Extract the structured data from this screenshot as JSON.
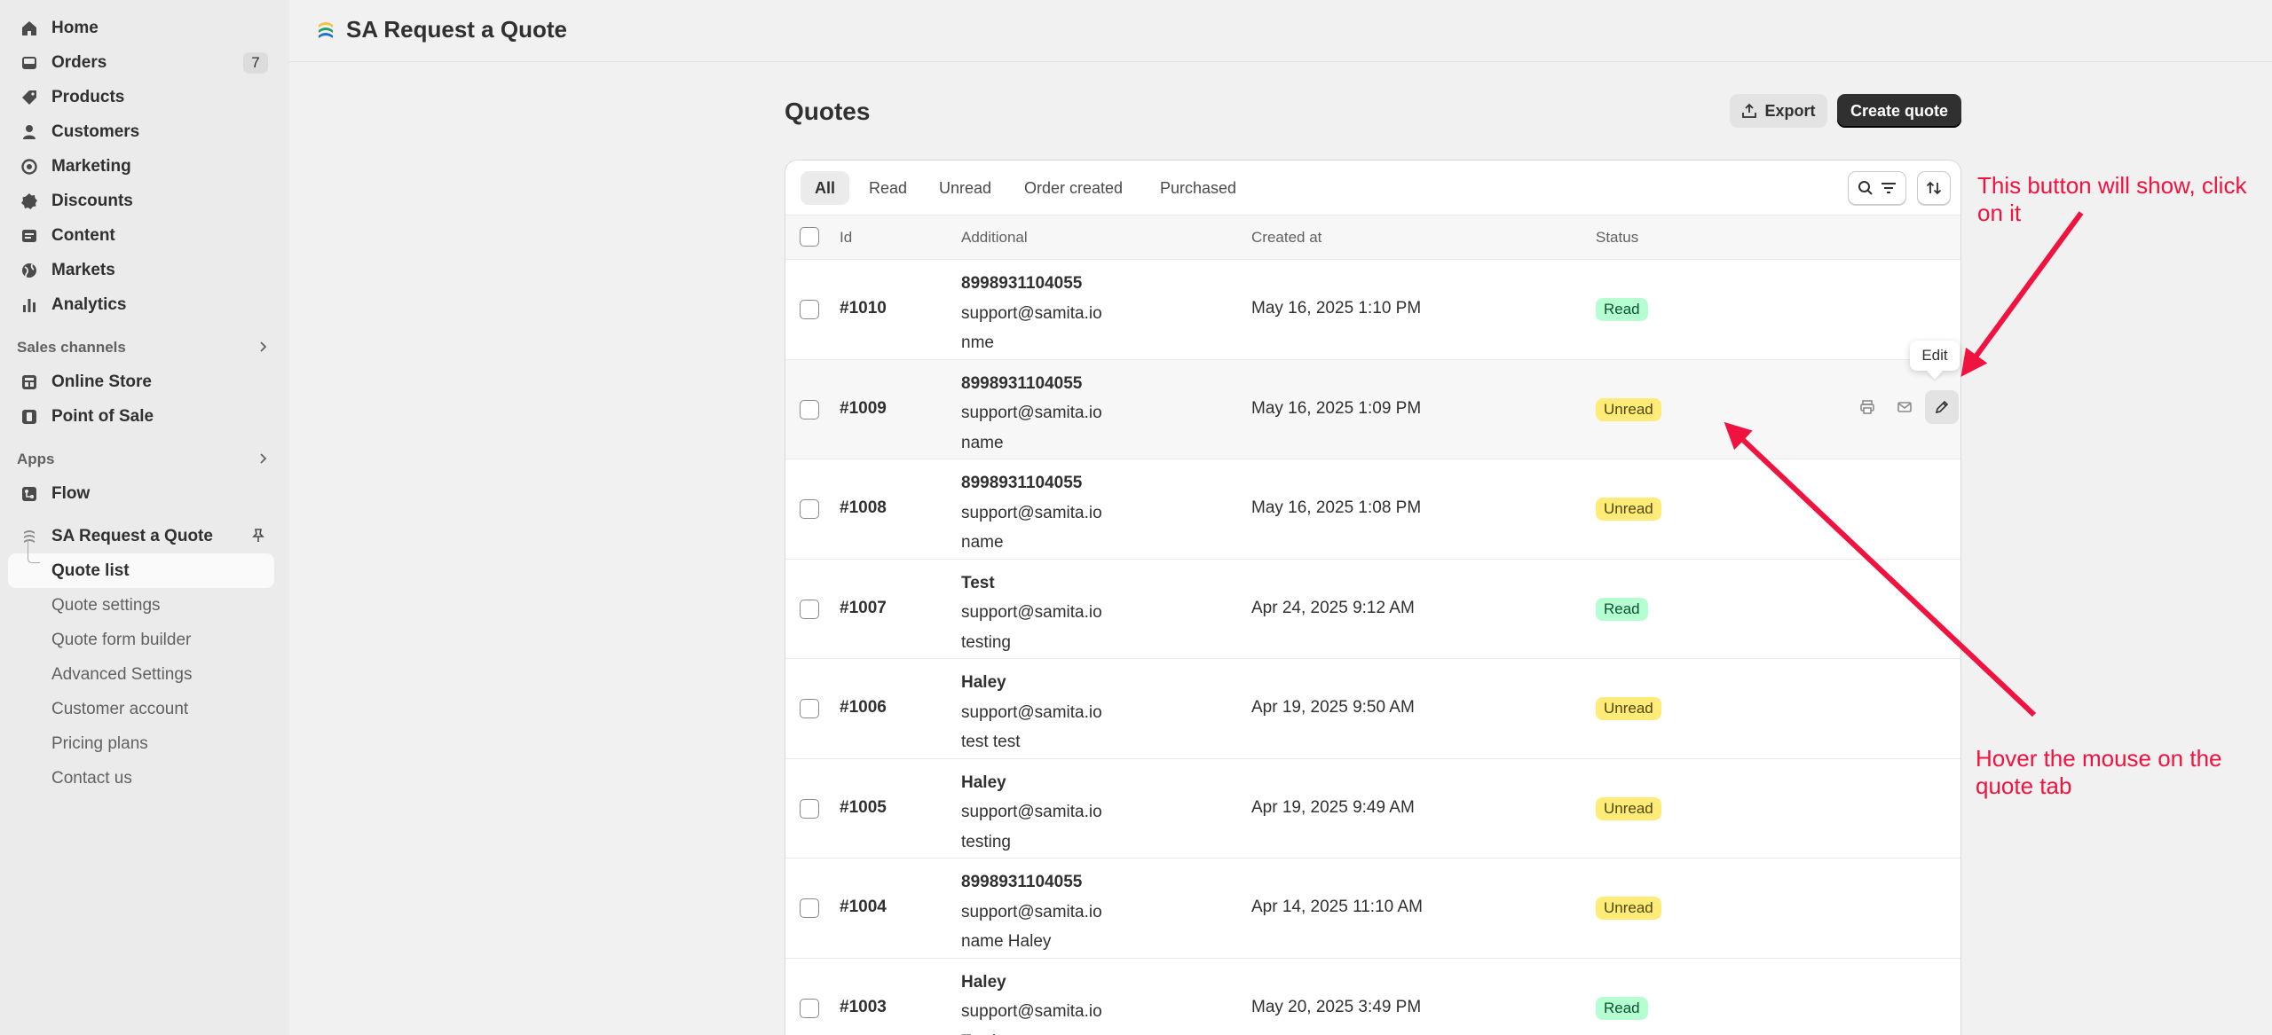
{
  "sidebar": {
    "nav": [
      {
        "label": "Home",
        "icon": "home-icon"
      },
      {
        "label": "Orders",
        "icon": "inbox-icon",
        "count": "7"
      },
      {
        "label": "Products",
        "icon": "tag-icon"
      },
      {
        "label": "Customers",
        "icon": "person-icon"
      },
      {
        "label": "Marketing",
        "icon": "target-icon"
      },
      {
        "label": "Discounts",
        "icon": "discount-icon"
      },
      {
        "label": "Content",
        "icon": "content-icon"
      },
      {
        "label": "Markets",
        "icon": "globe-icon"
      },
      {
        "label": "Analytics",
        "icon": "bar-chart-icon"
      }
    ],
    "sales_channels": {
      "title": "Sales channels",
      "items": [
        {
          "label": "Online Store",
          "icon": "store-icon"
        },
        {
          "label": "Point of Sale",
          "icon": "pos-icon"
        }
      ]
    },
    "apps": {
      "title": "Apps",
      "items": [
        {
          "label": "Flow",
          "icon": "flow-icon"
        }
      ]
    },
    "app": {
      "label": "SA Request a Quote",
      "sub": [
        "Quote list",
        "Quote settings",
        "Quote form builder",
        "Advanced Settings",
        "Customer account",
        "Pricing plans",
        "Contact us"
      ]
    }
  },
  "header": {
    "title": "SA Request a Quote"
  },
  "page": {
    "title": "Quotes",
    "export_label": "Export",
    "create_label": "Create quote"
  },
  "tabs": [
    "All",
    "Read",
    "Unread",
    "Order created",
    "Purchased"
  ],
  "table": {
    "headers": {
      "id": "Id",
      "additional": "Additional",
      "created": "Created at",
      "status": "Status"
    },
    "rows": [
      {
        "id": "#1010",
        "name": "8998931104055",
        "email": "support@samita.io",
        "note": "nme",
        "created": "May 16, 2025 1:10 PM",
        "status": "Read"
      },
      {
        "id": "#1009",
        "name": "8998931104055",
        "email": "support@samita.io",
        "note": "name",
        "created": "May 16, 2025 1:09 PM",
        "status": "Unread"
      },
      {
        "id": "#1008",
        "name": "8998931104055",
        "email": "support@samita.io",
        "note": "name",
        "created": "May 16, 2025 1:08 PM",
        "status": "Unread"
      },
      {
        "id": "#1007",
        "name": "Test",
        "email": "support@samita.io",
        "note": "testing",
        "created": "Apr 24, 2025 9:12 AM",
        "status": "Read"
      },
      {
        "id": "#1006",
        "name": "Haley",
        "email": "support@samita.io",
        "note": "test test",
        "created": "Apr 19, 2025 9:50 AM",
        "status": "Unread"
      },
      {
        "id": "#1005",
        "name": "Haley",
        "email": "support@samita.io",
        "note": "testing",
        "created": "Apr 19, 2025 9:49 AM",
        "status": "Unread"
      },
      {
        "id": "#1004",
        "name": "8998931104055",
        "email": "support@samita.io",
        "note": "name Haley",
        "created": "Apr 14, 2025 11:10 AM",
        "status": "Unread"
      },
      {
        "id": "#1003",
        "name": "Haley",
        "email": "support@samita.io",
        "note": "Testing",
        "created": "May 20, 2025 3:49 PM",
        "status": "Read"
      }
    ]
  },
  "tooltip": {
    "edit": "Edit"
  },
  "annotations": {
    "top": "This button will show, click on it",
    "bottom": "Hover the mouse on the quote tab"
  },
  "colors": {
    "annotation": "#f0123f",
    "read_badge": "#b4fed2",
    "unread_badge": "#ffeb78",
    "primary_button": "#303030"
  }
}
